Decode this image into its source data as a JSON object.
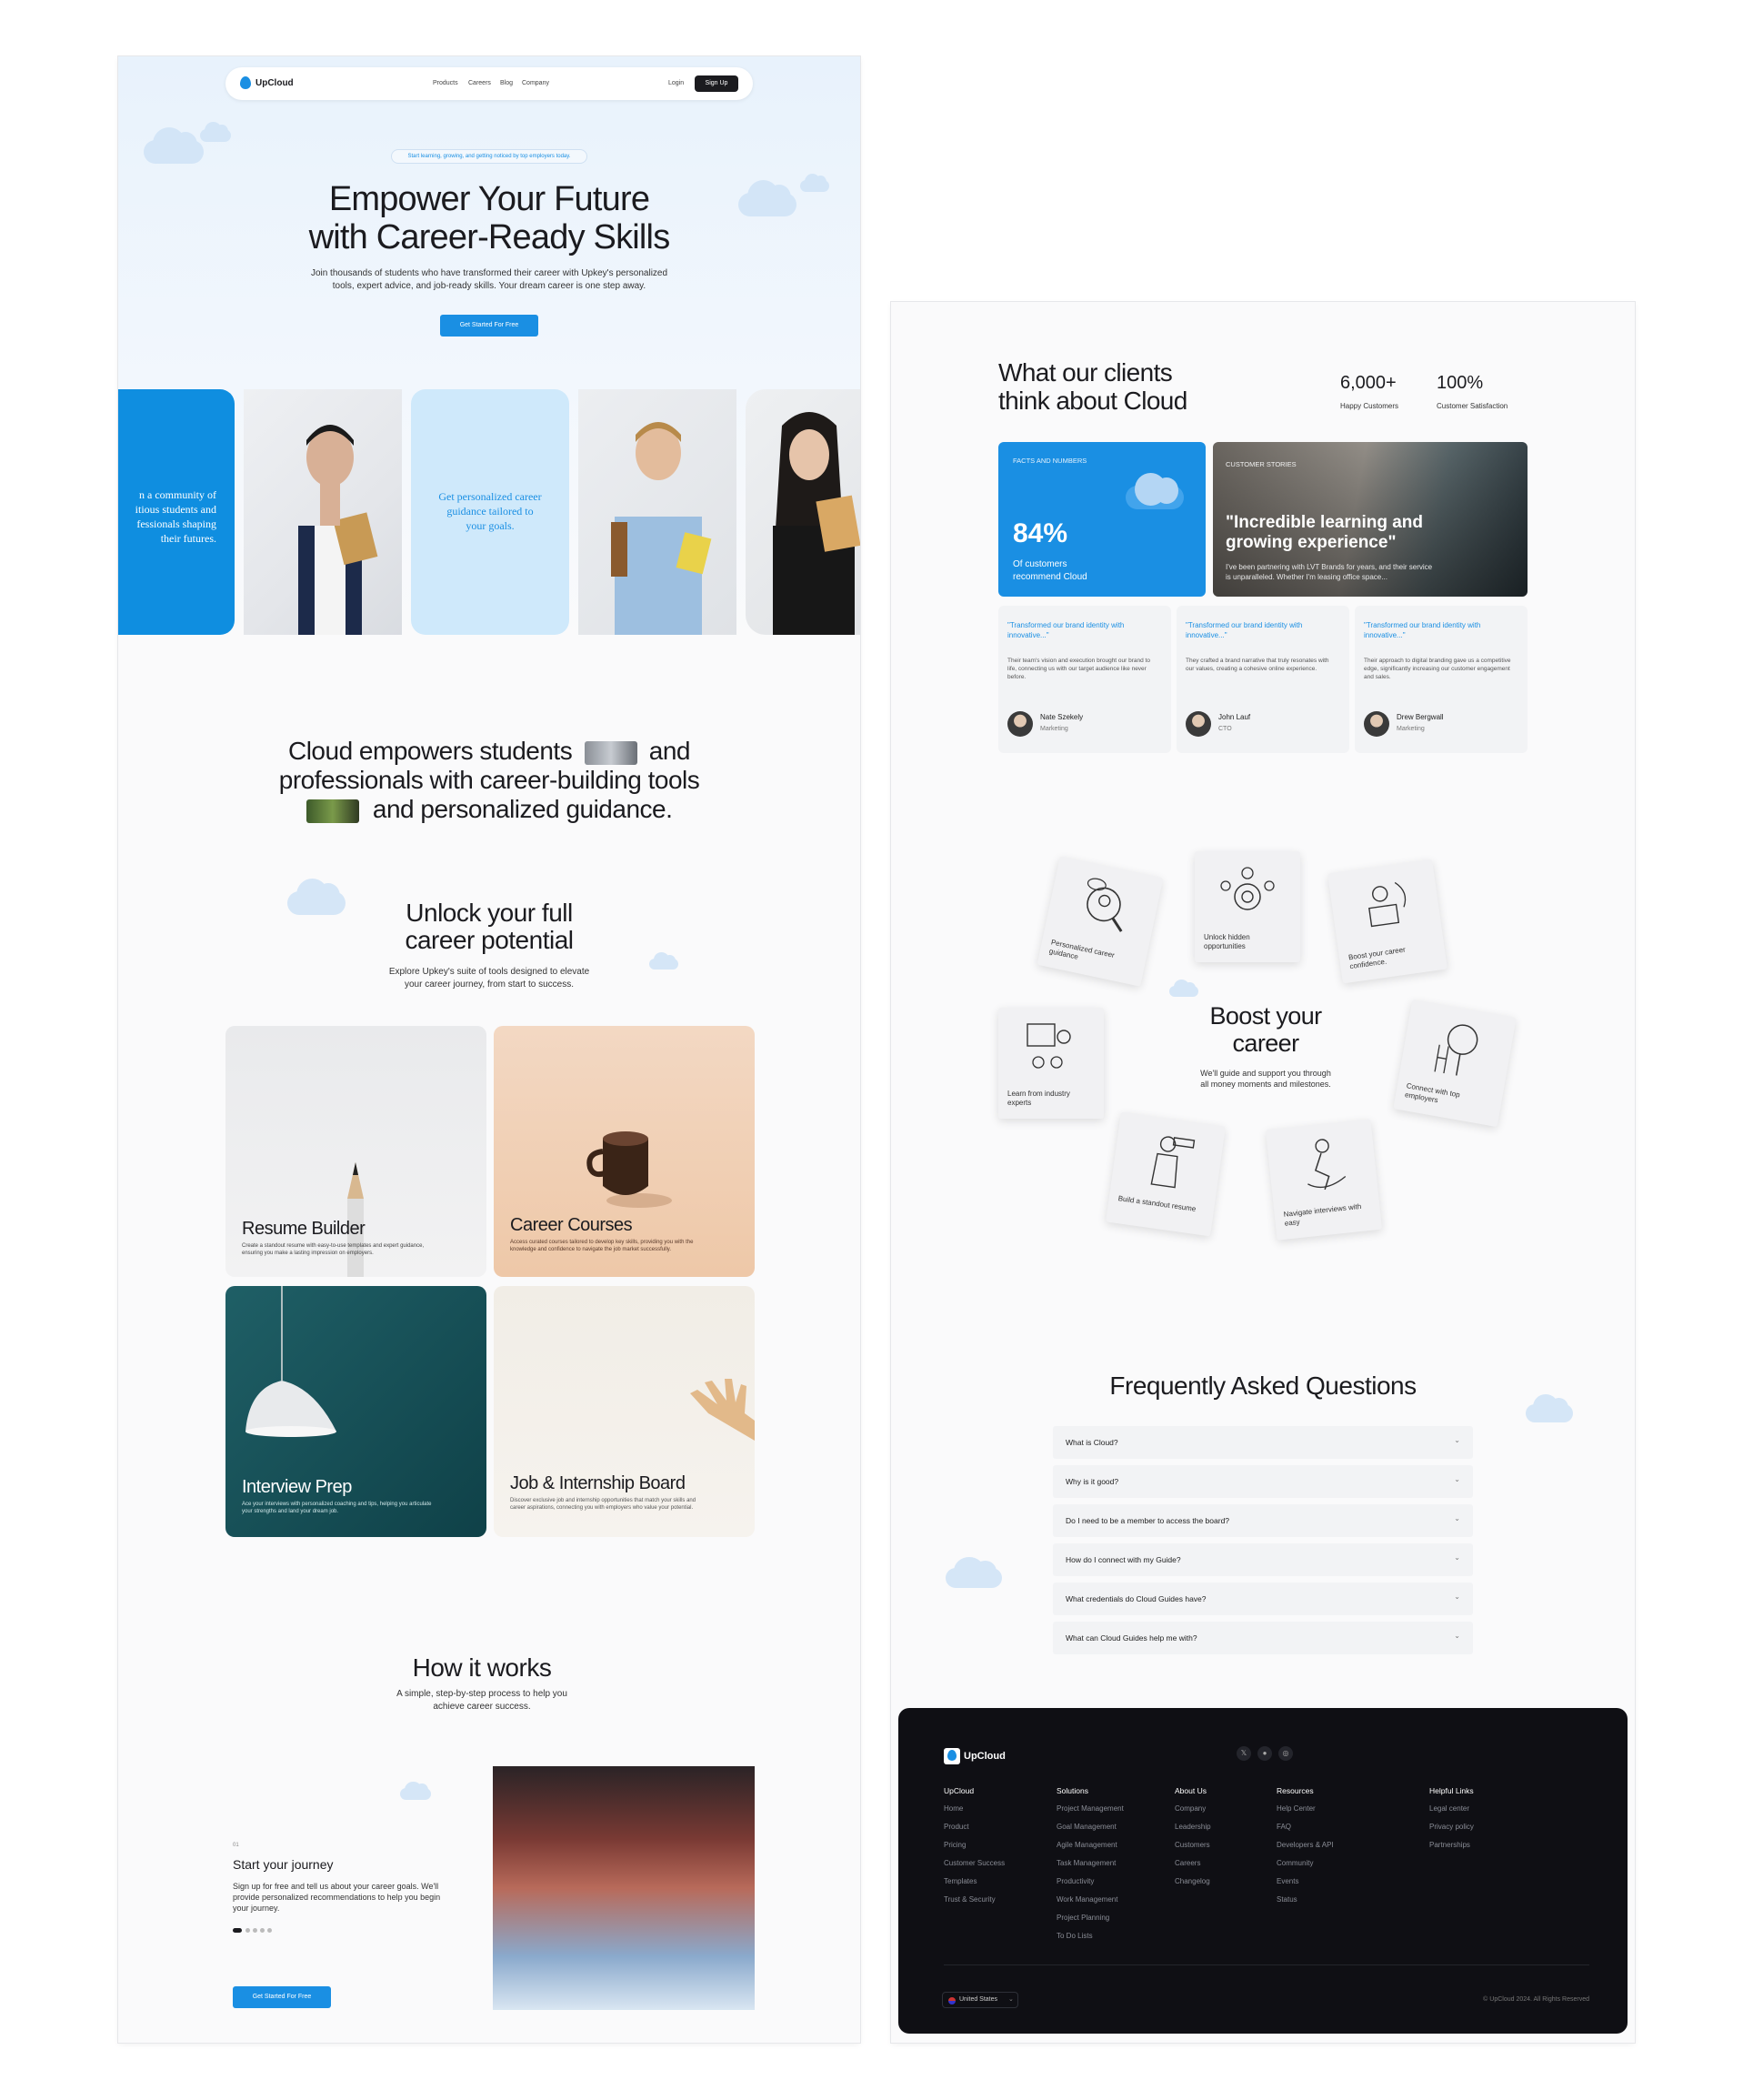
{
  "nav": {
    "brand": "UpCloud",
    "links": [
      "Products",
      "Careers",
      "Blog",
      "Company"
    ],
    "login": "Login",
    "signup": "Sign Up"
  },
  "hero": {
    "badge": "Start learning, growing, and getting noticed by top employers today.",
    "title_line1": "Empower Your Future",
    "title_line2": "with Career-Ready Skills",
    "subtitle_line1": "Join thousands of students who have transformed their career with Upkey's personalized",
    "subtitle_line2": "tools, expert advice, and job-ready skills. Your dream career is one step away.",
    "cta": "Get Started For Free"
  },
  "strip": {
    "card1": [
      "n a community of",
      "itious students and",
      "fessionals shaping",
      "their futures."
    ],
    "card2": [
      "Get personalized career",
      "guidance tailored to",
      "your goals."
    ]
  },
  "mission": {
    "line1a": "Cloud empowers students",
    "line1b": "and",
    "line2": "professionals with career-building tools",
    "line3": "and personalized guidance."
  },
  "unlock": {
    "title_line1": "Unlock your full",
    "title_line2": "career potential",
    "sub_line1": "Explore Upkey's suite of tools designed to elevate",
    "sub_line2": "your career journey, from start to success."
  },
  "features": [
    {
      "title": "Resume Builder",
      "desc": "Create a standout resume with easy-to-use templates and expert guidance, ensuring you make a lasting impression on employers."
    },
    {
      "title": "Career Courses",
      "desc": "Access curated courses tailored to develop key skills, providing you with the knowledge and confidence to navigate the job market successfully."
    },
    {
      "title": "Interview Prep",
      "desc": "Ace your interviews with personalized coaching and tips, helping you articulate your strengths and land your dream job."
    },
    {
      "title": "Job & Internship Board",
      "desc": "Discover exclusive job and internship opportunities that match your skills and career aspirations, connecting you with employers who value your potential."
    }
  ],
  "how": {
    "title": "How it works",
    "sub_line1": "A simple, step-by-step process to help you",
    "sub_line2": "achieve career success.",
    "step_num": "01",
    "step_title": "Start your journey",
    "step_desc": "Sign up for free and tell us about your career goals. We'll provide personalized recommendations to help you begin your journey.",
    "cta": "Get Started For Free"
  },
  "clients": {
    "title_line1": "What our clients",
    "title_line2": "think about Cloud",
    "stats": [
      {
        "num": "6,000+",
        "label": "Happy Customers"
      },
      {
        "num": "100%",
        "label": "Customer Satisfaction"
      }
    ],
    "facts": {
      "kicker": "FACTS AND NUMBERS",
      "num": "84%",
      "line1": "Of customers",
      "line2": "recommend Cloud"
    },
    "story": {
      "kicker": "CUSTOMER STORIES",
      "quote_line1": "\"Incredible learning and",
      "quote_line2": "growing experience\"",
      "body_line1": "I've been partnering with LVT Brands for years, and their service",
      "body_line2": "is unparalleled. Whether I'm leasing office space..."
    },
    "testimonials": [
      {
        "quote": "\"Transformed our brand identity with innovative...\"",
        "body": "Their team's vision and execution brought our brand to life, connecting us with our target audience like never before.",
        "name": "Nate Szekely",
        "role": "Marketing"
      },
      {
        "quote": "\"Transformed our brand identity with innovative...\"",
        "body": "They crafted a brand narrative that truly resonates with our values, creating a cohesive online experience.",
        "name": "John Lauf",
        "role": "CTO"
      },
      {
        "quote": "\"Transformed our brand identity with innovative...\"",
        "body": "Their approach to digital branding gave us a competitive edge, significantly increasing our customer engagement and sales.",
        "name": "Drew Bergwall",
        "role": "Marketing"
      }
    ]
  },
  "boost": {
    "title_line1": "Boost your",
    "title_line2": "career",
    "sub_line1": "We'll guide and support you through",
    "sub_line2": "all money moments and milestones.",
    "tiles": [
      "Personalized career guidance",
      "Unlock hidden opportunities",
      "Boost your career confidence.",
      "Learn from industry experts",
      "Connect with top employers",
      "Build a standout resume",
      "Navigate interviews with easy"
    ]
  },
  "faq": {
    "title": "Frequently Asked Questions",
    "items": [
      "What is Cloud?",
      "Why is it good?",
      "Do I need to be a member to access the board?",
      "How do I connect with my Guide?",
      "What credentials do Cloud Guides have?",
      "What can Cloud Guides help me with?"
    ]
  },
  "footer": {
    "brand": "UpCloud",
    "columns": [
      {
        "title": "UpCloud",
        "items": [
          "Home",
          "Product",
          "Pricing",
          "Customer Success",
          "Templates",
          "Trust & Security"
        ]
      },
      {
        "title": "Solutions",
        "items": [
          "Project Management",
          "Goal Management",
          "Agile Management",
          "Task Management",
          "Productivity",
          "Work Management",
          "Project Planning",
          "To Do Lists"
        ]
      },
      {
        "title": "About Us",
        "items": [
          "Company",
          "Leadership",
          "Customers",
          "Careers",
          "Changelog"
        ]
      },
      {
        "title": "Resources",
        "items": [
          "Help Center",
          "FAQ",
          "Developers & API",
          "Community",
          "Events",
          "Status"
        ]
      },
      {
        "title": "Helpful Links",
        "items": [
          "Legal center",
          "Privacy policy",
          "Partnerships"
        ]
      }
    ],
    "locale": "United States",
    "copyright": "© UpCloud 2024. All Rights Reserved"
  },
  "colors": {
    "accent": "#1a8fe3",
    "dark": "#0f0f14"
  }
}
